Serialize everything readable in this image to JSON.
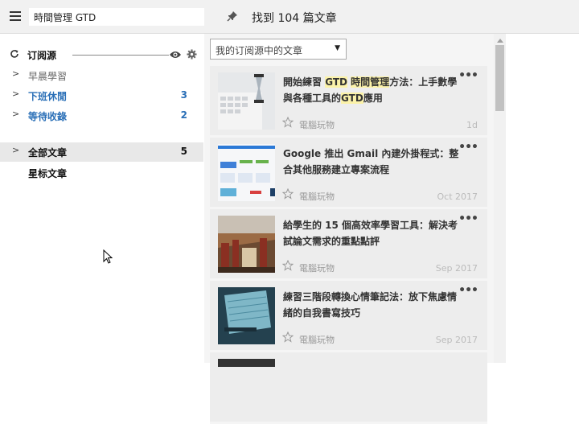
{
  "topbar": {
    "search_value": "時間管理 GTD",
    "result_title": "找到 104 篇文章"
  },
  "sidebar": {
    "section_title": "订阅源",
    "feeds": [
      {
        "label": "早晨學習",
        "count": ""
      },
      {
        "label": "下班休閒",
        "count": "3"
      },
      {
        "label": "等待收錄",
        "count": "2"
      }
    ],
    "all_articles": {
      "label": "全部文章",
      "count": "5"
    },
    "starred": {
      "label": "星标文章"
    }
  },
  "main": {
    "filter_label": "我的订阅源中的文章",
    "articles": [
      {
        "title_parts": [
          "開始練習 ",
          "GTD",
          " ",
          "時間管理",
          "方法：上手數學與各種工具的",
          "GTD",
          "應用"
        ],
        "highlights": [
          1,
          3,
          5
        ],
        "source": "電腦玩物",
        "date": "1d"
      },
      {
        "title_parts": [
          "Google 推出 Gmail 內建外掛程式：整合其他服務建立專案流程"
        ],
        "highlights": [],
        "source": "電腦玩物",
        "date": "Oct 2017"
      },
      {
        "title_parts": [
          "給學生的 15 個高效率學習工具：解決考試論文需求的重點點評"
        ],
        "highlights": [],
        "source": "電腦玩物",
        "date": "Sep 2017"
      },
      {
        "title_parts": [
          "練習三階段轉換心情筆記法：放下焦慮情緒的自我書寫技巧"
        ],
        "highlights": [],
        "source": "電腦玩物",
        "date": "Sep 2017"
      }
    ]
  },
  "icons": {
    "menu": "hamburger-icon",
    "pin": "pin-icon",
    "refresh": "refresh-icon",
    "eye": "eye-icon",
    "gear": "gear-icon",
    "star": "star-outline-icon"
  },
  "colors": {
    "accent": "#2a6fb7",
    "highlight": "#fbf2a9"
  }
}
